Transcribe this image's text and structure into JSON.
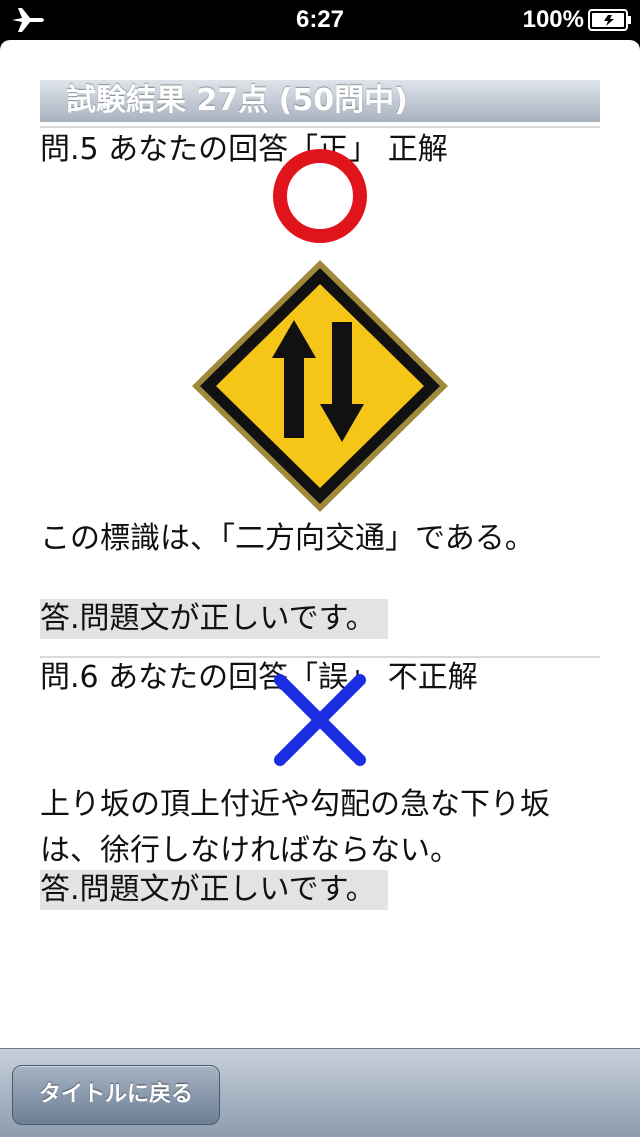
{
  "status_bar": {
    "time": "6:27",
    "battery_percent": "100%",
    "icons": [
      "airplane-icon",
      "battery-icon"
    ]
  },
  "header": {
    "title": "試験結果 27点 (50問中)"
  },
  "questions": [
    {
      "line": "問.5 あなたの回答「正」 正解",
      "mark": "circle-correct",
      "mark_color": "#e0151b",
      "sign": "two-way-traffic-sign",
      "text": "この標識は、「二方向交通」である。",
      "answer": "答.問題文が正しいです。"
    },
    {
      "line": "問.6 あなたの回答「誤」 不正解",
      "mark": "cross-incorrect",
      "mark_color": "#1a2de0",
      "text": "上り坂の頂上付近や勾配の急な下り坂は、徐行しなければならない。",
      "answer": "答.問題文が正しいです。"
    }
  ],
  "toolbar": {
    "back_label": "タイトルに戻る"
  },
  "colors": {
    "sign_yellow": "#f5c518",
    "sign_black": "#111111",
    "header_gradient_top": "#dfe4ea",
    "header_gradient_bottom": "#a8b2bf",
    "answer_background": "#e3e3e3"
  }
}
